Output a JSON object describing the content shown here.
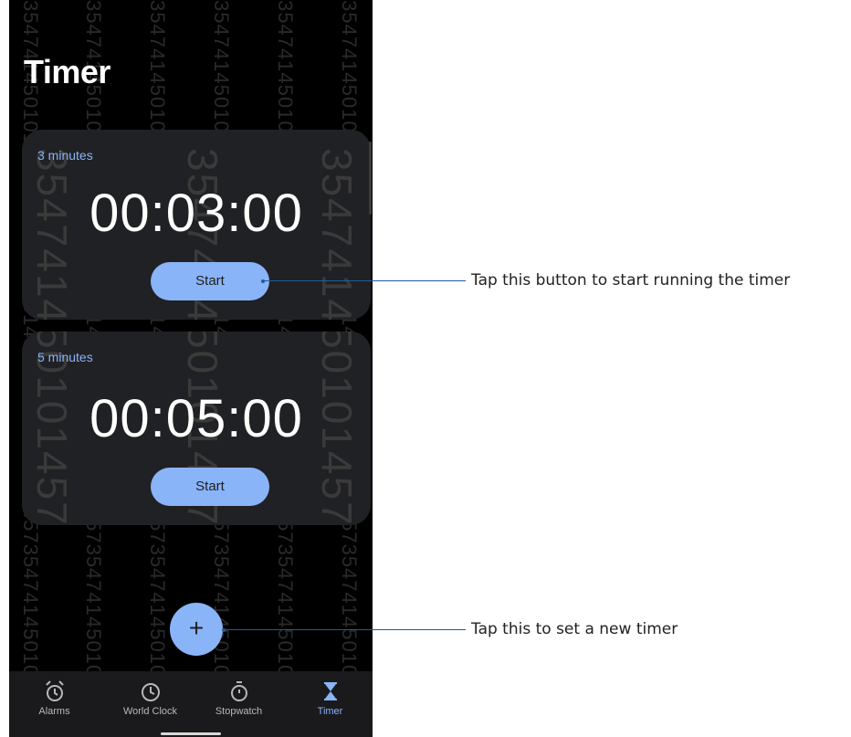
{
  "screen": {
    "title": "Timer",
    "watermark_small": "3547414501014573547414501014573547414501014573547414501014",
    "watermark_big": "354741450101457"
  },
  "timers": [
    {
      "label": "3 minutes",
      "time": "00:03:00",
      "button_label": "Start"
    },
    {
      "label": "5 minutes",
      "time": "00:05:00",
      "button_label": "Start"
    }
  ],
  "fab": {
    "icon": "plus-icon",
    "symbol": "+"
  },
  "nav": {
    "items": [
      {
        "label": "Alarms",
        "icon": "alarm-clock-icon",
        "active": false
      },
      {
        "label": "World Clock",
        "icon": "clock-icon",
        "active": false
      },
      {
        "label": "Stopwatch",
        "icon": "stopwatch-icon",
        "active": false
      },
      {
        "label": "Timer",
        "icon": "hourglass-icon",
        "active": true
      }
    ]
  },
  "callouts": {
    "start": "Tap this button to start running the timer",
    "add": "Tap this to set a new timer"
  },
  "colors": {
    "accent": "#8ab4f8",
    "card_bg": "#202124",
    "screen_bg": "#000000",
    "callout_line": "#1e5c9a"
  }
}
